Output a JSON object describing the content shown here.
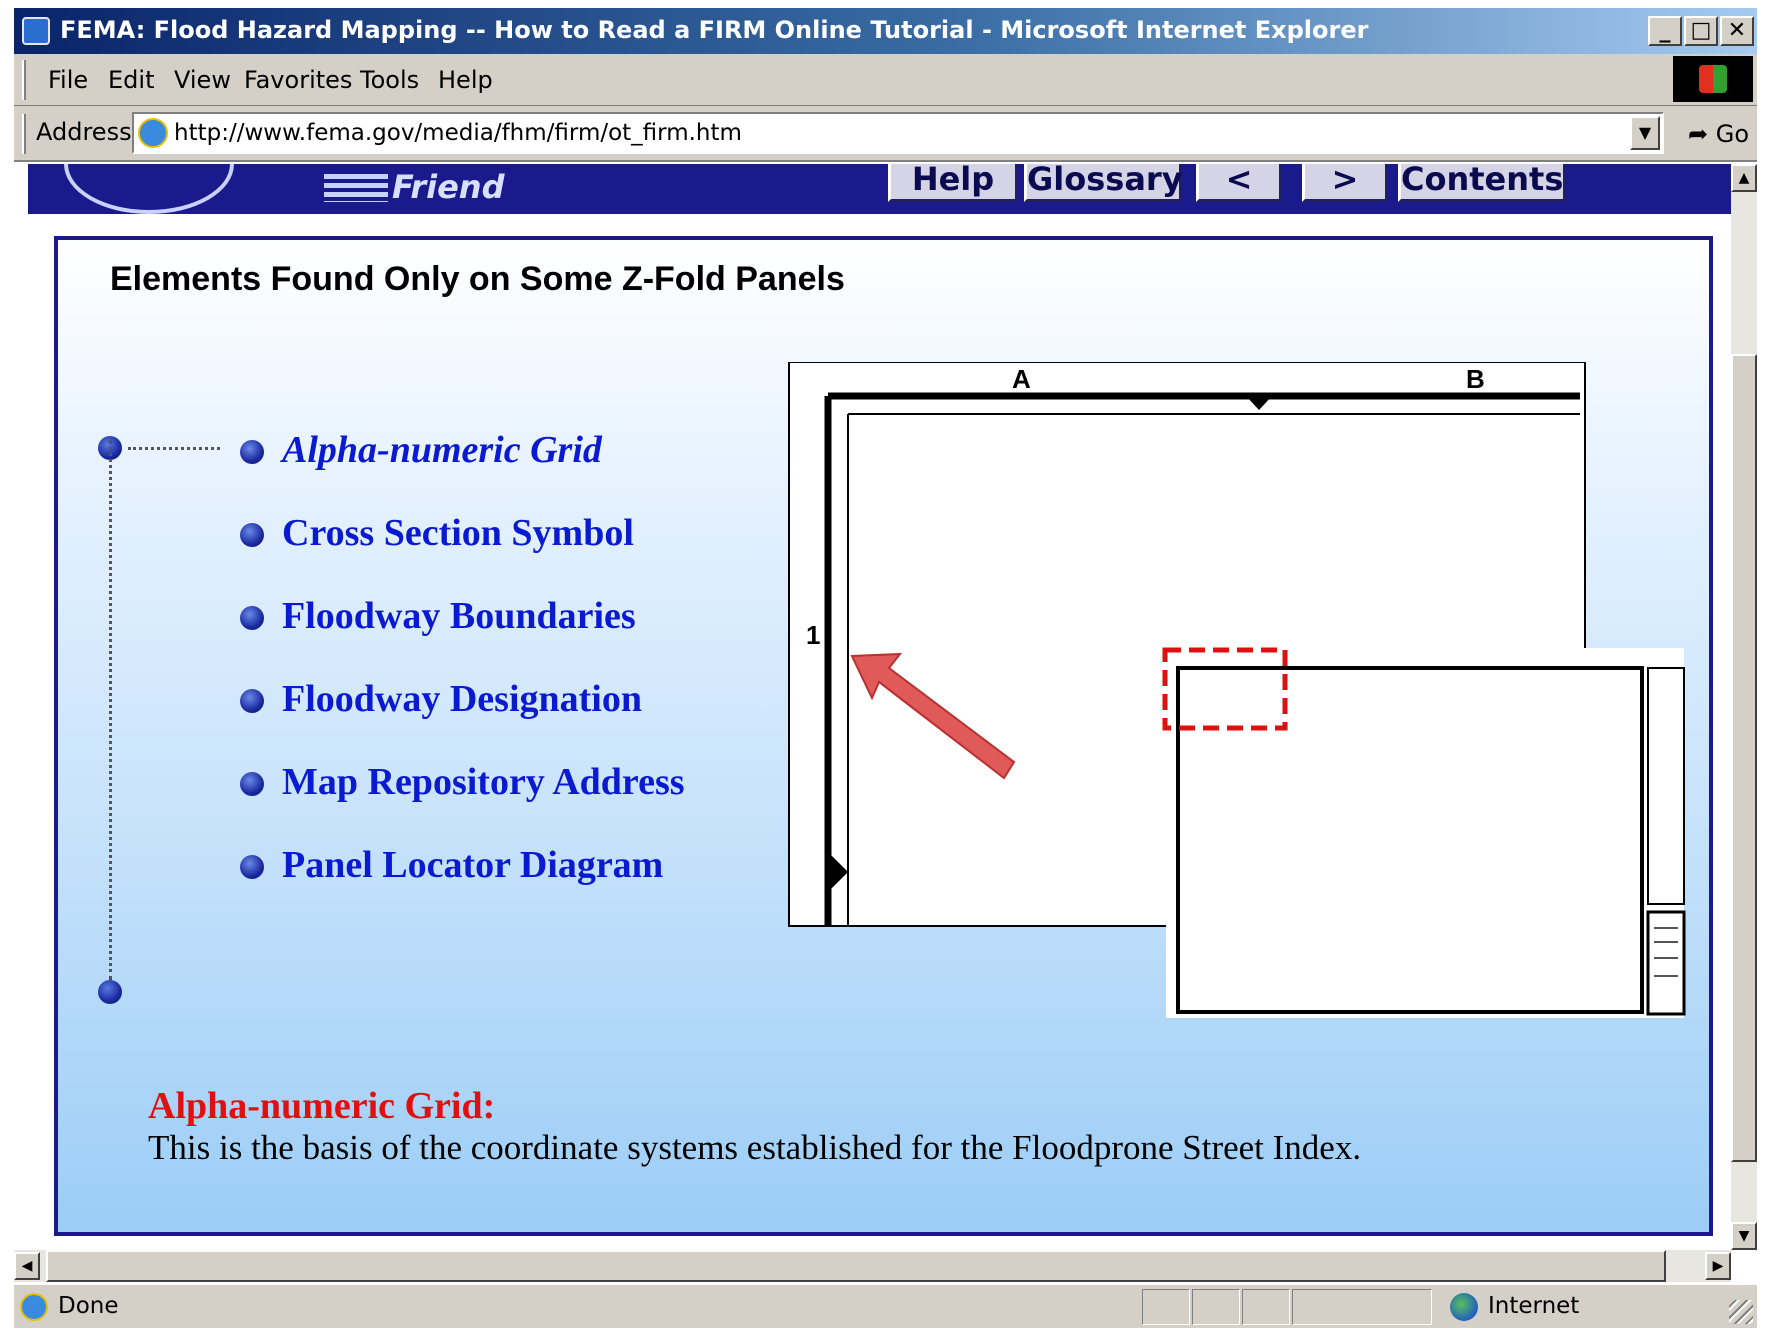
{
  "window": {
    "title": "FEMA: Flood Hazard Mapping -- How to Read a FIRM Online Tutorial - Microsoft Internet Explorer",
    "minimize": "_",
    "maximize": "□",
    "close": "✕"
  },
  "menu": {
    "items": [
      {
        "label": "File"
      },
      {
        "label": "Edit"
      },
      {
        "label": "View"
      },
      {
        "label": "Favorites"
      },
      {
        "label": "Tools"
      },
      {
        "label": "Help"
      }
    ]
  },
  "address": {
    "label": "Address",
    "url": "http://www.fema.gov/media/fhm/firm/ot_firm.htm",
    "dropdown": "▼",
    "go": "Go"
  },
  "site": {
    "tell_friend": "Friend",
    "nav": {
      "help": "Help",
      "glossary": "Glossary",
      "prev": "<",
      "next": ">",
      "contents": "Contents"
    }
  },
  "page": {
    "title": "Elements Found Only on Some Z-Fold Panels",
    "topics": [
      {
        "label": "Alpha-numeric Grid",
        "active": true
      },
      {
        "label": "Cross Section Symbol",
        "active": false
      },
      {
        "label": "Floodway Boundaries",
        "active": false
      },
      {
        "label": "Floodway Designation",
        "active": false
      },
      {
        "label": "Map Repository Address",
        "active": false
      },
      {
        "label": "Panel Locator Diagram",
        "active": false
      }
    ],
    "description": {
      "title": "Alpha-numeric Grid:",
      "text": "This is the basis of the coordinate systems established for the Floodprone Street Index."
    }
  },
  "diagram": {
    "col_a": "A",
    "col_b": "B",
    "row_1": "1",
    "arrow_color": "#e05a5a",
    "highlight_color": "#e01010"
  },
  "scroll": {
    "up": "▲",
    "down": "▼",
    "left": "◀",
    "right": "▶"
  },
  "status": {
    "text": "Done",
    "zone": "Internet"
  }
}
